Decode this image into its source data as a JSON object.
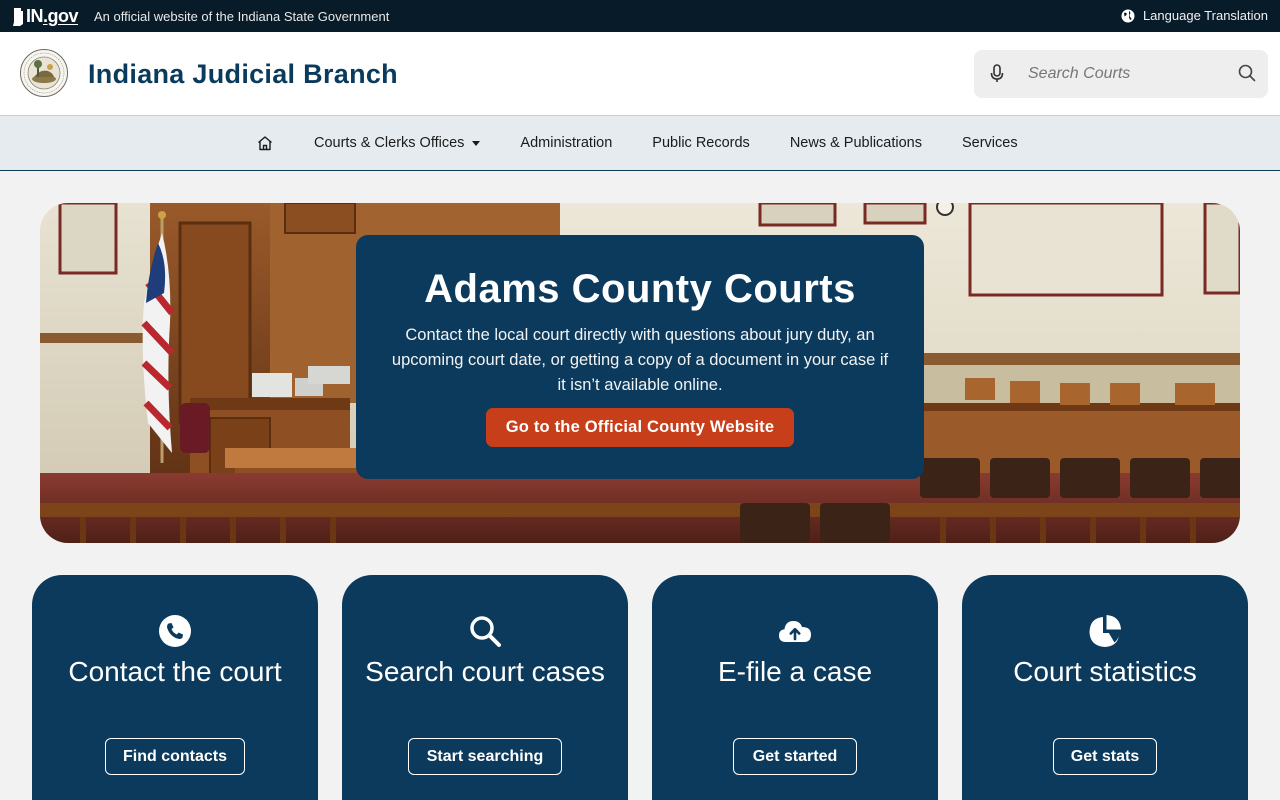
{
  "topbar": {
    "logo_in": "IN",
    "logo_gov": ".gov",
    "official_text": "An official website of the Indiana State Government",
    "language_label": "Language Translation"
  },
  "header": {
    "site_title": "Indiana Judicial Branch",
    "search_placeholder": "Search Courts"
  },
  "nav": {
    "items": [
      {
        "label": "Courts & Clerks Offices"
      },
      {
        "label": "Administration"
      },
      {
        "label": "Public Records"
      },
      {
        "label": "News & Publications"
      },
      {
        "label": "Services"
      }
    ]
  },
  "hero": {
    "title": "Adams County Courts",
    "description": "Contact the local court directly with questions about jury duty, an upcoming court date, or getting a copy of a document in your case if it isn’t available online.",
    "button_label": "Go to the Official County Website"
  },
  "cards": [
    {
      "title": "Contact the court",
      "button": "Find contacts",
      "icon": "phone-icon"
    },
    {
      "title": "Search court cases",
      "button": "Start searching",
      "icon": "search-icon"
    },
    {
      "title": "E-file a case",
      "button": "Get started",
      "icon": "cloud-upload-icon"
    },
    {
      "title": "Court statistics",
      "button": "Get stats",
      "icon": "pie-chart-icon"
    }
  ],
  "colors": {
    "navy": "#0b3a5c",
    "topbar": "#081b28",
    "accent": "#c63f1a",
    "nav_bg": "#e6ebef"
  }
}
